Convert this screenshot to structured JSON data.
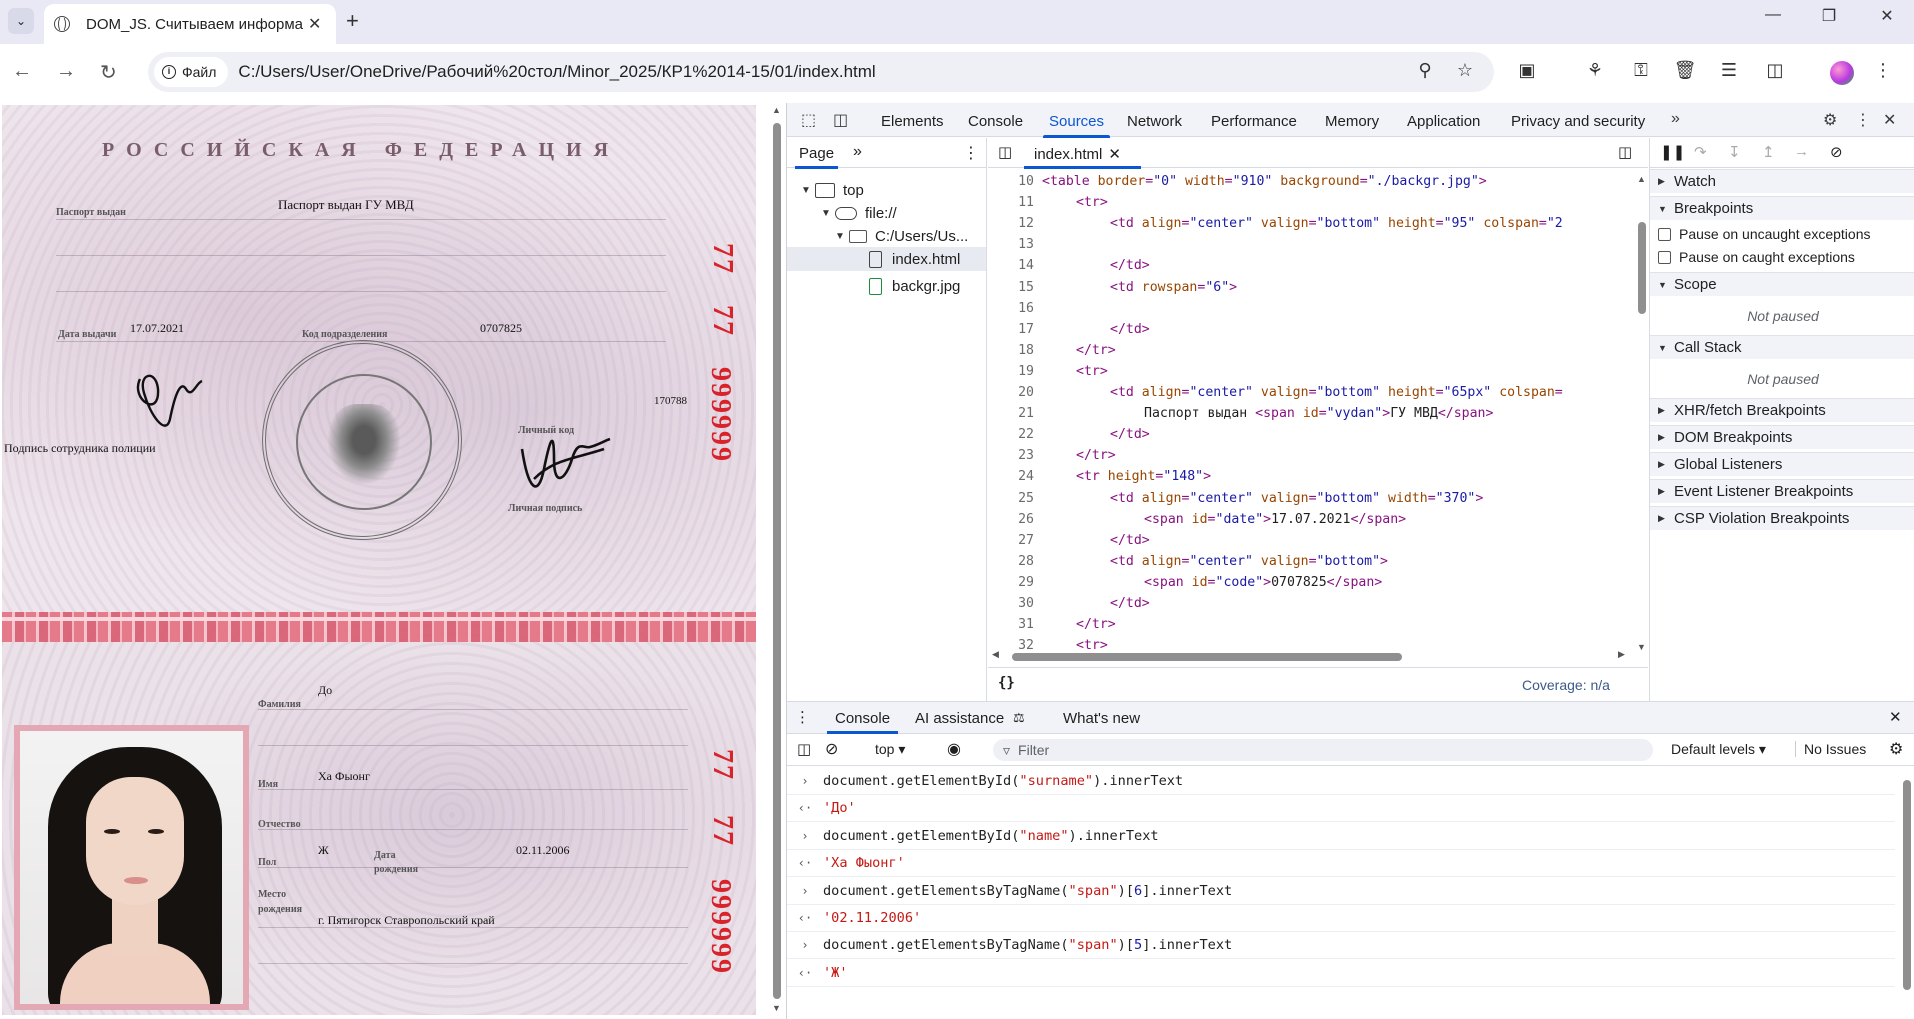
{
  "browser": {
    "tab_title": "DOM_JS. Считываем информа",
    "site_chip": "Файл",
    "url": "C:/Users/User/OneDrive/Рабочий%20стол/Minor_2025/КР1%2014-15/01/index.html"
  },
  "passport": {
    "header": "РОССИЙСКАЯ ФЕДЕРАЦИЯ",
    "labels": {
      "issued": "Паспорт выдан",
      "date": "Дата выдачи",
      "code": "Код подразделения",
      "personal_code": "Личный код",
      "personal_sign": "Личная подпись",
      "officer_sign": "Подпись сотрудника полиции",
      "surname": "Фамилия",
      "name": "Имя",
      "patronymic": "Отчество",
      "sex": "Пол",
      "dob": "Дата рождения",
      "birthplace": "Место рождения"
    },
    "issued_by": "Паспорт выдан ГУ МВД",
    "issue_date": "17.07.2021",
    "division_code": "0707825",
    "personal_number": "170788",
    "surname": "До",
    "name": "Ха Фыонг",
    "sex": "Ж",
    "birth_date": "02.11.2006",
    "birth_place": "г. Пятигорск Ставропольский край",
    "series_top": [
      "77",
      "77"
    ],
    "number_top": "999999",
    "series_bottom": [
      "77",
      "77"
    ],
    "number_bottom": "999999"
  },
  "devtools": {
    "tabs": [
      "Elements",
      "Console",
      "Sources",
      "Network",
      "Performance",
      "Memory",
      "Application",
      "Privacy and security"
    ],
    "active_tab": "Sources",
    "navigator": {
      "tab": "Page",
      "tree": [
        "top",
        "file://",
        "C:/Users/Us...",
        "index.html",
        "backgr.jpg"
      ]
    },
    "editor": {
      "file_tab": "index.html",
      "coverage": "Coverage: n/a",
      "lines": [
        {
          "n": "10",
          "html": "<span class='c-tag'>&lt;table</span> <span class='c-attr'>border</span>=<span class='c-val'>\"0\"</span> <span class='c-attr'>width</span>=<span class='c-val'>\"910\"</span> <span class='c-attr'>background</span>=<span class='c-val'>\"./backgr.jpg\"</span><span class='c-tag'>&gt;</span>",
          "indent": 1
        },
        {
          "n": "11",
          "html": "<span class='c-tag'>&lt;tr&gt;</span>",
          "indent": 2
        },
        {
          "n": "12",
          "html": "<span class='c-tag'>&lt;td</span> <span class='c-attr'>align</span>=<span class='c-val'>\"center\"</span> <span class='c-attr'>valign</span>=<span class='c-val'>\"bottom\"</span> <span class='c-attr'>height</span>=<span class='c-val'>\"95\"</span> <span class='c-attr'>colspan</span>=<span class='c-val'>\"2</span>",
          "indent": 3
        },
        {
          "n": "13",
          "html": "",
          "indent": 3
        },
        {
          "n": "14",
          "html": "<span class='c-tag'>&lt;/td&gt;</span>",
          "indent": 3
        },
        {
          "n": "15",
          "html": "<span class='c-tag'>&lt;td</span> <span class='c-attr'>rowspan</span>=<span class='c-val'>\"6\"</span><span class='c-tag'>&gt;</span>",
          "indent": 3
        },
        {
          "n": "16",
          "html": "",
          "indent": 3
        },
        {
          "n": "17",
          "html": "<span class='c-tag'>&lt;/td&gt;</span>",
          "indent": 3
        },
        {
          "n": "18",
          "html": "<span class='c-tag'>&lt;/tr&gt;</span>",
          "indent": 2
        },
        {
          "n": "19",
          "html": "<span class='c-tag'>&lt;tr&gt;</span>",
          "indent": 2
        },
        {
          "n": "20",
          "html": "<span class='c-tag'>&lt;td</span> <span class='c-attr'>align</span>=<span class='c-val'>\"center\"</span> <span class='c-attr'>valign</span>=<span class='c-val'>\"bottom\"</span> <span class='c-attr'>height</span>=<span class='c-val'>\"65px\"</span> <span class='c-attr'>colspan</span>=",
          "indent": 3
        },
        {
          "n": "21",
          "html": "<span class='c-txt'>Паспорт выдан </span><span class='c-tag'>&lt;span</span> <span class='c-attr'>id</span>=<span class='c-val'>\"vydan\"</span><span class='c-tag'>&gt;</span><span class='c-txt'>ГУ МВД</span><span class='c-tag'>&lt;/span&gt;</span>",
          "indent": 4
        },
        {
          "n": "22",
          "html": "<span class='c-tag'>&lt;/td&gt;</span>",
          "indent": 3
        },
        {
          "n": "23",
          "html": "<span class='c-tag'>&lt;/tr&gt;</span>",
          "indent": 2
        },
        {
          "n": "24",
          "html": "<span class='c-tag'>&lt;tr</span> <span class='c-attr'>height</span>=<span class='c-val'>\"148\"</span><span class='c-tag'>&gt;</span>",
          "indent": 2
        },
        {
          "n": "25",
          "html": "<span class='c-tag'>&lt;td</span> <span class='c-attr'>align</span>=<span class='c-val'>\"center\"</span> <span class='c-attr'>valign</span>=<span class='c-val'>\"bottom\"</span> <span class='c-attr'>width</span>=<span class='c-val'>\"370\"</span><span class='c-tag'>&gt;</span>",
          "indent": 3
        },
        {
          "n": "26",
          "html": "<span class='c-tag'>&lt;span</span> <span class='c-attr'>id</span>=<span class='c-val'>\"date\"</span><span class='c-tag'>&gt;</span><span class='c-txt'>17.07.2021</span><span class='c-tag'>&lt;/span&gt;</span>",
          "indent": 4
        },
        {
          "n": "27",
          "html": "<span class='c-tag'>&lt;/td&gt;</span>",
          "indent": 3
        },
        {
          "n": "28",
          "html": "<span class='c-tag'>&lt;td</span> <span class='c-attr'>align</span>=<span class='c-val'>\"center\"</span> <span class='c-attr'>valign</span>=<span class='c-val'>\"bottom\"</span><span class='c-tag'>&gt;</span>",
          "indent": 3
        },
        {
          "n": "29",
          "html": "<span class='c-tag'>&lt;span</span> <span class='c-attr'>id</span>=<span class='c-val'>\"code\"</span><span class='c-tag'>&gt;</span><span class='c-txt'>0707825</span><span class='c-tag'>&lt;/span&gt;</span>",
          "indent": 4
        },
        {
          "n": "30",
          "html": "<span class='c-tag'>&lt;/td&gt;</span>",
          "indent": 3
        },
        {
          "n": "31",
          "html": "<span class='c-tag'>&lt;/tr&gt;</span>",
          "indent": 2
        },
        {
          "n": "32",
          "html": "<span class='c-tag'>&lt;tr&gt;</span>",
          "indent": 2
        }
      ]
    },
    "debugger": {
      "watch": "Watch",
      "breakpoints": "Breakpoints",
      "pause_uncaught": "Pause on uncaught exceptions",
      "pause_caught": "Pause on caught exceptions",
      "scope": "Scope",
      "not_paused": "Not paused",
      "call_stack": "Call Stack",
      "sections": [
        "XHR/fetch Breakpoints",
        "DOM Breakpoints",
        "Global Listeners",
        "Event Listener Breakpoints",
        "CSP Violation Breakpoints"
      ]
    },
    "drawer": {
      "tabs": [
        "Console",
        "AI assistance",
        "What's new"
      ],
      "context": "top",
      "filter_placeholder": "Filter",
      "levels": "Default levels",
      "issues": "No Issues",
      "entries": [
        {
          "type": "in",
          "html": "<span class='c-code'>document.getElementById(</span><span class='c-str'>\"surname\"</span><span class='c-code'>).innerText</span>"
        },
        {
          "type": "out",
          "html": "<span class='c-str'>'До'</span>"
        },
        {
          "type": "in",
          "html": "<span class='c-code'>document.getElementById(</span><span class='c-str'>\"name\"</span><span class='c-code'>).innerText</span>"
        },
        {
          "type": "out",
          "html": "<span class='c-str'>'Ха Фыонг'</span>"
        },
        {
          "type": "in",
          "html": "<span class='c-code'>document.getElementsByTagName(</span><span class='c-str'>\"span\"</span><span class='c-code'>)[</span><span class='c-val'>6</span><span class='c-code'>].innerText</span>"
        },
        {
          "type": "out",
          "html": "<span class='c-str'>'02.11.2006'</span>"
        },
        {
          "type": "in",
          "html": "<span class='c-code'>document.getElementsByTagName(</span><span class='c-str'>\"span\"</span><span class='c-code'>)[</span><span class='c-val'>5</span><span class='c-code'>].innerText</span>"
        },
        {
          "type": "out",
          "html": "<span class='c-str'>'Ж'</span>"
        }
      ]
    }
  }
}
